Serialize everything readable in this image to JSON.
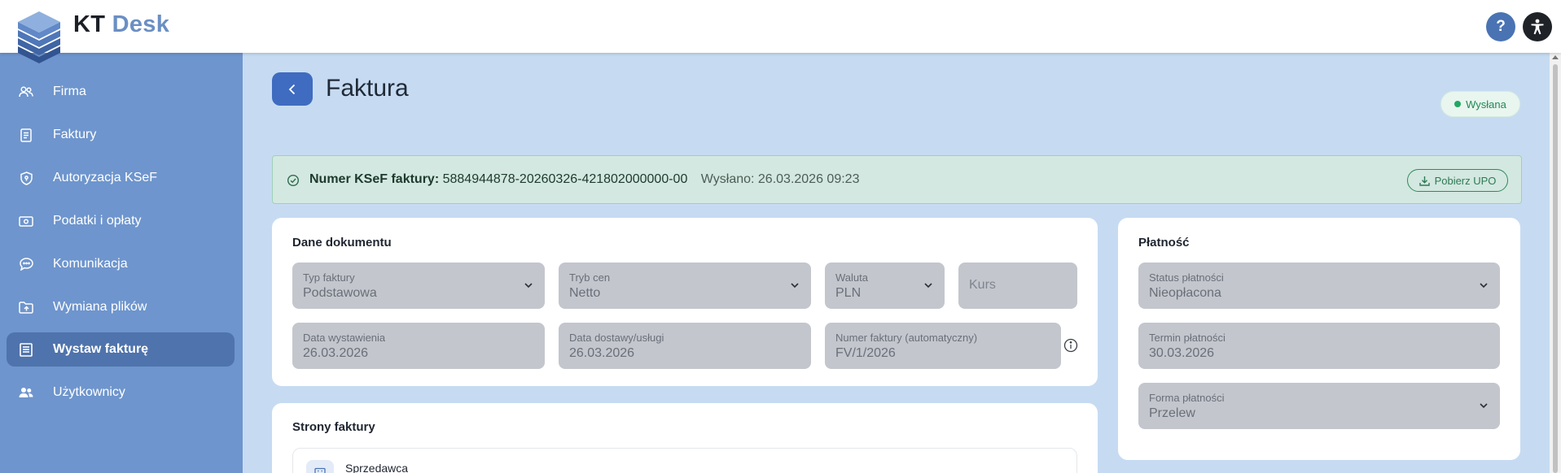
{
  "app": {
    "brand_kt": "KT",
    "brand_desk": "Desk",
    "help_label": "?"
  },
  "sidebar": {
    "items": [
      {
        "label": "Firma",
        "icon": "people-icon",
        "active": false
      },
      {
        "label": "Faktury",
        "icon": "document-icon",
        "active": false
      },
      {
        "label": "Autoryzacja KSeF",
        "icon": "shield-icon",
        "active": false
      },
      {
        "label": "Podatki i opłaty",
        "icon": "cash-icon",
        "active": false
      },
      {
        "label": "Komunikacja",
        "icon": "chat-icon",
        "active": false
      },
      {
        "label": "Wymiana plików",
        "icon": "folder-icon",
        "active": false
      },
      {
        "label": "Wystaw fakturę",
        "icon": "invoice-icon",
        "active": true
      },
      {
        "label": "Użytkownicy",
        "icon": "users-icon",
        "active": false
      }
    ]
  },
  "page": {
    "title": "Faktura",
    "status": "Wysłana"
  },
  "ksef": {
    "number_label": "Numer KSeF faktury:",
    "number": "5884944878-20260326-421802000000-00",
    "sent": "Wysłano: 26.03.2026 09:23",
    "upo_button": "Pobierz UPO"
  },
  "document": {
    "title": "Dane dokumentu",
    "typ_faktury": {
      "label": "Typ faktury",
      "value": "Podstawowa"
    },
    "tryb_cen": {
      "label": "Tryb cen",
      "value": "Netto"
    },
    "waluta": {
      "label": "Waluta",
      "value": "PLN"
    },
    "kurs": {
      "placeholder": "Kurs"
    },
    "data_wystawienia": {
      "label": "Data wystawienia",
      "value": "26.03.2026"
    },
    "data_dostawy": {
      "label": "Data dostawy/usługi",
      "value": "26.03.2026"
    },
    "numer_faktury": {
      "label": "Numer faktury (automatyczny)",
      "value": "FV/1/2026"
    }
  },
  "payment": {
    "title": "Płatność",
    "status": {
      "label": "Status płatności",
      "value": "Nieopłacona"
    },
    "termin": {
      "label": "Termin płatności",
      "value": "30.03.2026"
    },
    "forma": {
      "label": "Forma płatności",
      "value": "Przelew"
    }
  },
  "parties": {
    "title": "Strony faktury",
    "seller_label": "Sprzedawca"
  },
  "colors": {
    "sidebar": "#6e95cd",
    "sidebar_active": "#4f73ac",
    "accent": "#3f6cc0",
    "background": "#c6dbf2",
    "success": "#22a863"
  }
}
